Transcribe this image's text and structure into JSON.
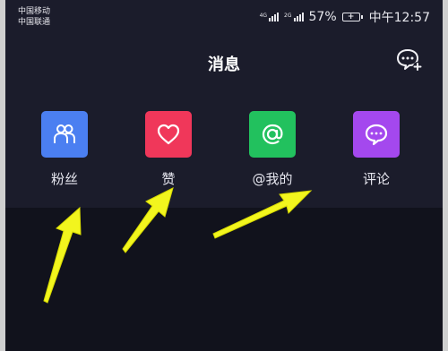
{
  "status_bar": {
    "carrier_1": "中国移动",
    "carrier_2": "中国联通",
    "signal_1_label": "4G",
    "signal_2_label": "2G",
    "battery_percent": "57%",
    "time": "中午12:57"
  },
  "header": {
    "title": "消息"
  },
  "categories": [
    {
      "label": "粉丝",
      "icon": "fans-icon",
      "color": "#4b7ff1"
    },
    {
      "label": "赞",
      "icon": "heart-icon",
      "color": "#f0375a"
    },
    {
      "label": "@我的",
      "icon": "at-icon",
      "color": "#22c15e"
    },
    {
      "label": "评论",
      "icon": "comment-icon",
      "color": "#a448ee"
    }
  ],
  "colors": {
    "background": "#1b1c2b",
    "lower_background": "#11121c",
    "arrow_annotation": "#f2f51e"
  }
}
